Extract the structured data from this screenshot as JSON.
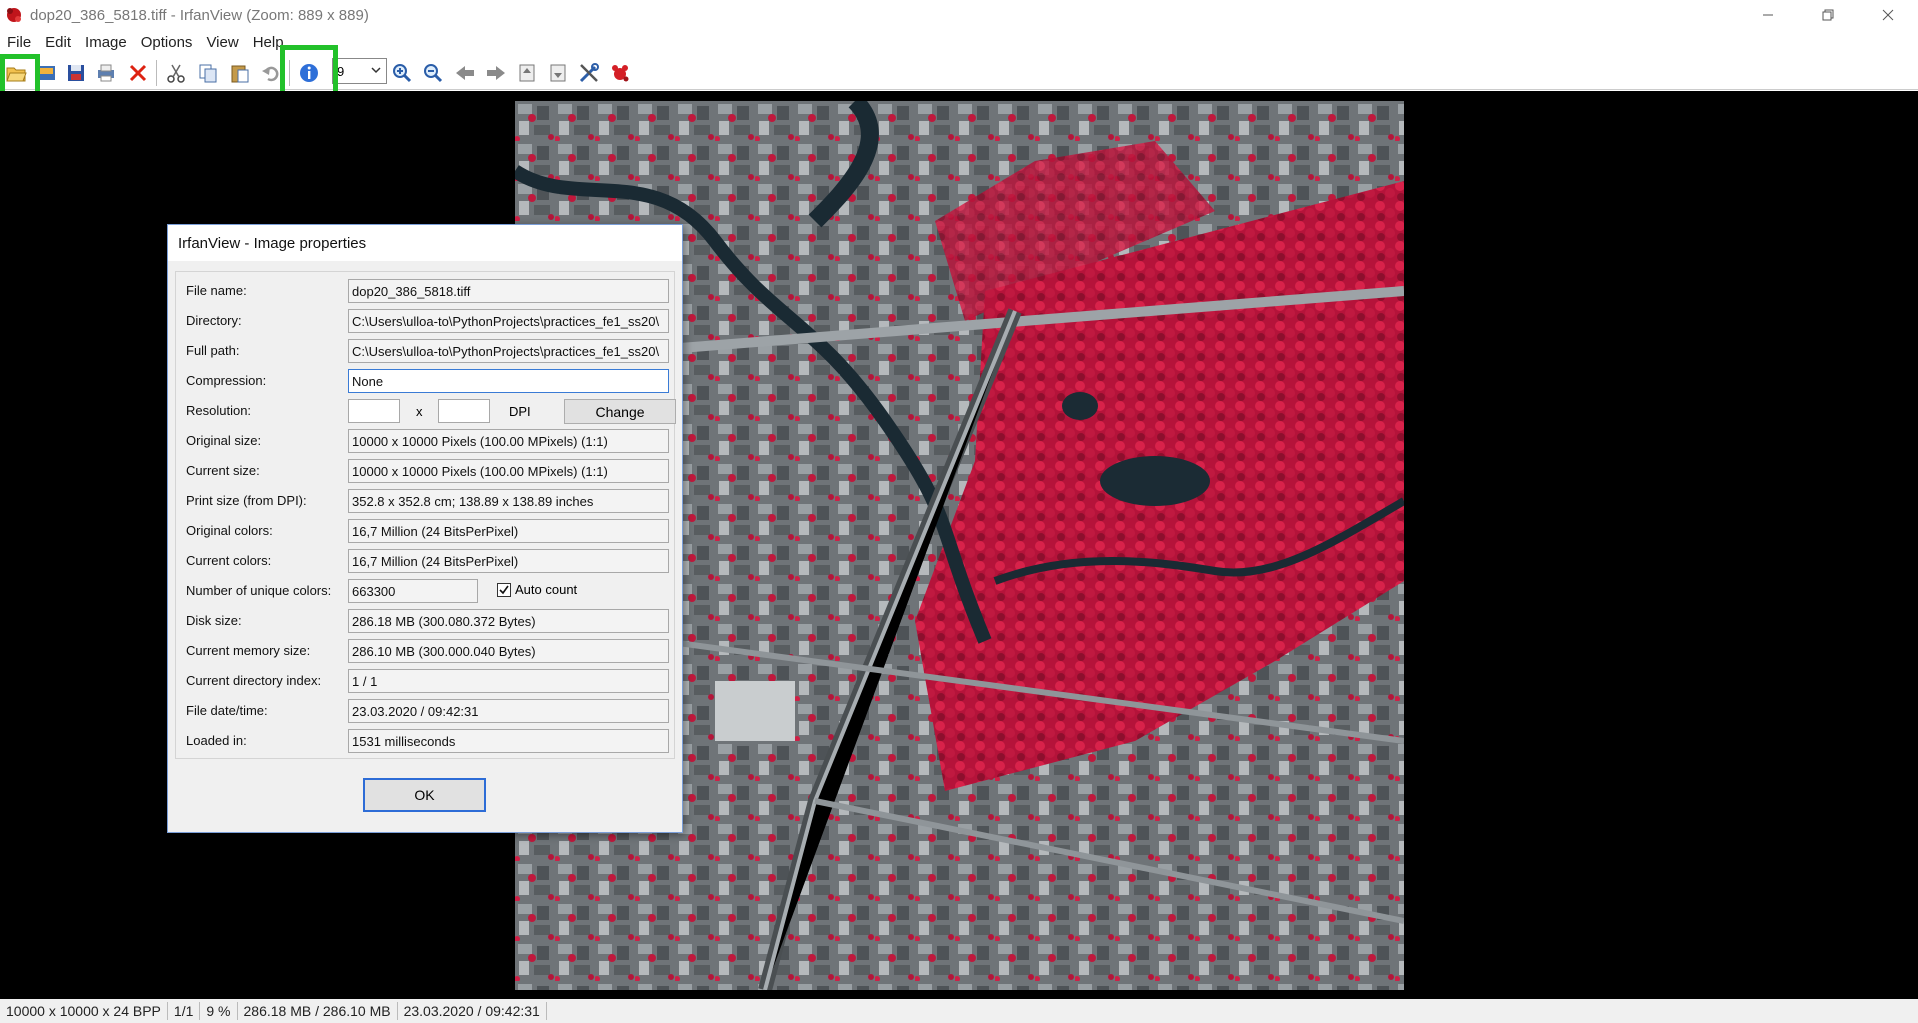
{
  "window": {
    "title": "dop20_386_5818.tiff - IrfanView (Zoom: 889 x 889)"
  },
  "menu": [
    "File",
    "Edit",
    "Image",
    "Options",
    "View",
    "Help"
  ],
  "toolbar": {
    "zoom_value": "9",
    "buttons": [
      "open-folder-icon",
      "thumbnails-icon",
      "save-icon",
      "print-icon",
      "delete-icon",
      "cut-icon",
      "copy-icon",
      "paste-icon",
      "undo-icon",
      "info-icon",
      "zoom-in-icon",
      "zoom-out-icon",
      "previous-icon",
      "next-icon",
      "first-page-icon",
      "last-page-icon",
      "tools-icon",
      "irfanview-icon"
    ]
  },
  "dialog": {
    "title": "IrfanView - Image properties",
    "rows": [
      {
        "label": "File name:",
        "value": "dop20_386_5818.tiff"
      },
      {
        "label": "Directory:",
        "value": "C:\\Users\\ulloa-to\\PythonProjects\\practices_fe1_ss20\\"
      },
      {
        "label": "Full path:",
        "value": "C:\\Users\\ulloa-to\\PythonProjects\\practices_fe1_ss20\\"
      },
      {
        "label": "Compression:",
        "value": "None"
      },
      {
        "label": "Resolution:",
        "value": ""
      },
      {
        "label": "Original size:",
        "value": "10000 x 10000  Pixels (100.00 MPixels) (1:1)"
      },
      {
        "label": "Current size:",
        "value": "10000 x 10000  Pixels (100.00 MPixels) (1:1)"
      },
      {
        "label": "Print size (from DPI):",
        "value": "352.8 x 352.8 cm; 138.89 x 138.89 inches"
      },
      {
        "label": "Original colors:",
        "value": "16,7 Million   (24 BitsPerPixel)"
      },
      {
        "label": "Current colors:",
        "value": "16,7 Million   (24 BitsPerPixel)"
      },
      {
        "label": "Number of unique colors:",
        "value": "663300"
      },
      {
        "label": "Disk size:",
        "value": "286.18 MB (300.080.372 Bytes)"
      },
      {
        "label": "Current memory size:",
        "value": "286.10  MB (300.000.040 Bytes)"
      },
      {
        "label": "Current directory index:",
        "value": "1  /  1"
      },
      {
        "label": "File date/time:",
        "value": "23.03.2020 / 09:42:31"
      },
      {
        "label": "Loaded in:",
        "value": "1531 milliseconds"
      }
    ],
    "resolution_x_sep": "x",
    "resolution_unit": "DPI",
    "change_label": "Change",
    "auto_count_label": "Auto count",
    "ok_label": "OK"
  },
  "statusbar": [
    "10000 x 10000 x 24 BPP",
    "1/1",
    "9 %",
    "286.18 MB / 286.10 MB",
    "23.03.2020 / 09:42:31"
  ],
  "colors": {
    "highlight": "#22c12a",
    "photo_red": "#c8193c",
    "accent": "#2d6cd6"
  }
}
